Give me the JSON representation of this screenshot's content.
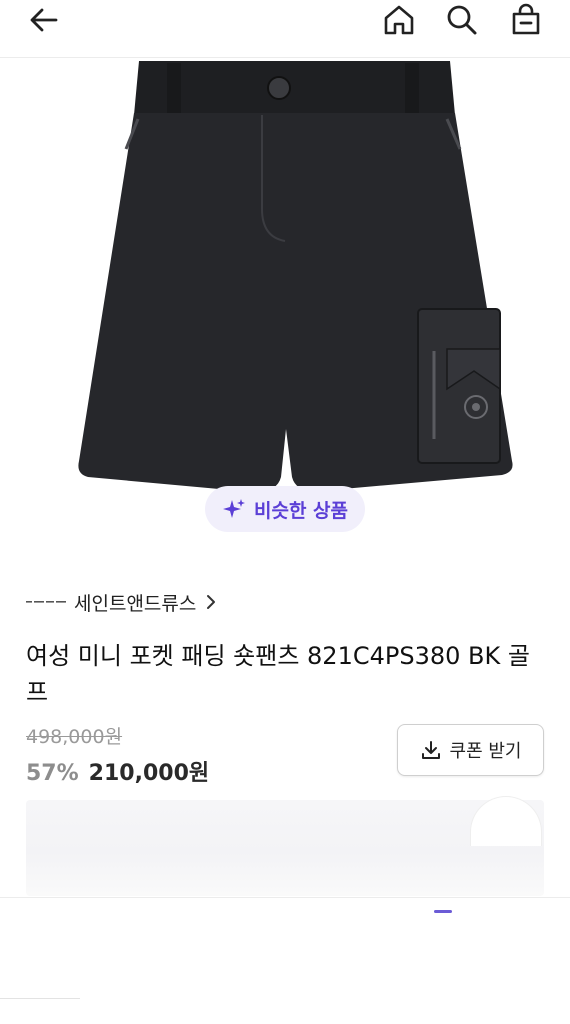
{
  "header": {
    "back_icon": "arrow-left-icon",
    "home_icon": "home-icon",
    "search_icon": "search-icon",
    "cart_icon": "shopping-bag-icon"
  },
  "similar_products": {
    "label": "비슷한 상품",
    "icon": "sparkle-icon",
    "accent_color": "#5b3fd6"
  },
  "brand": {
    "name": "세인트앤드류스",
    "chevron_icon": "chevron-right-icon"
  },
  "product": {
    "title": "여성 미니 포켓 패딩 숏팬츠 821C4PS380 BK 골프",
    "original_price": "498,000원",
    "discount": "57%",
    "price": "210,000원"
  },
  "coupon": {
    "label": "쿠폰 받기",
    "icon": "download-icon"
  }
}
